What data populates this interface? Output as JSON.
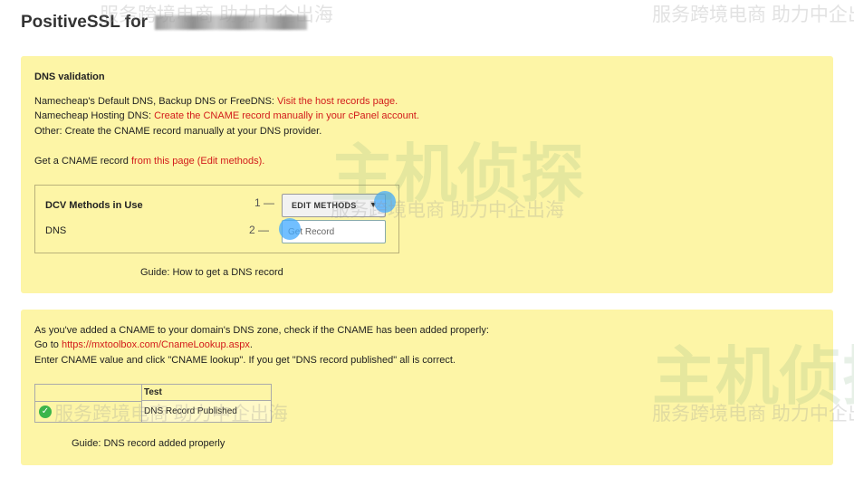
{
  "page": {
    "title_prefix": "PositiveSSL for"
  },
  "dns_validation": {
    "heading": "DNS validation",
    "line1_prefix": "Namecheap's Default DNS, Backup DNS or FreeDNS: ",
    "line1_link": "Visit the host records page.",
    "line2_prefix": "Namecheap Hosting DNS: ",
    "line2_link": "Create the CNAME record manually in your cPanel account.",
    "line3": "Other: Create the CNAME record manually at your DNS provider.",
    "line4_prefix": "Get a CNAME record ",
    "line4_link": "from this page (Edit methods).",
    "dcv": {
      "heading": "DCV Methods in Use",
      "method": "DNS",
      "step1": "1 —",
      "step2": "2 —",
      "edit_button": "EDIT METHODS",
      "get_record": "Get Record"
    },
    "guide": "Guide: How to get a DNS record"
  },
  "check_cname": {
    "line1": "As you've added a CNAME to your domain's DNS zone, check if the CNAME has been added properly:",
    "line2_prefix": "Go to ",
    "line2_link": "https://mxtoolbox.com/CnameLookup.aspx",
    "line2_suffix": ".",
    "line3": "Enter CNAME value and click \"CNAME lookup\". If you get \"DNS record published\" all is correct.",
    "table_header": "Test",
    "table_value": "DNS Record Published",
    "guide": "Guide: DNS record added properly"
  },
  "watermark": {
    "text": "服务跨境电商 助力中企出海",
    "big": "主机侦探"
  },
  "colors": {
    "panel_bg": "#fdf5a6",
    "link": "#d21b1b",
    "check": "#3bb54a",
    "highlight_dot": "#42aaff"
  }
}
